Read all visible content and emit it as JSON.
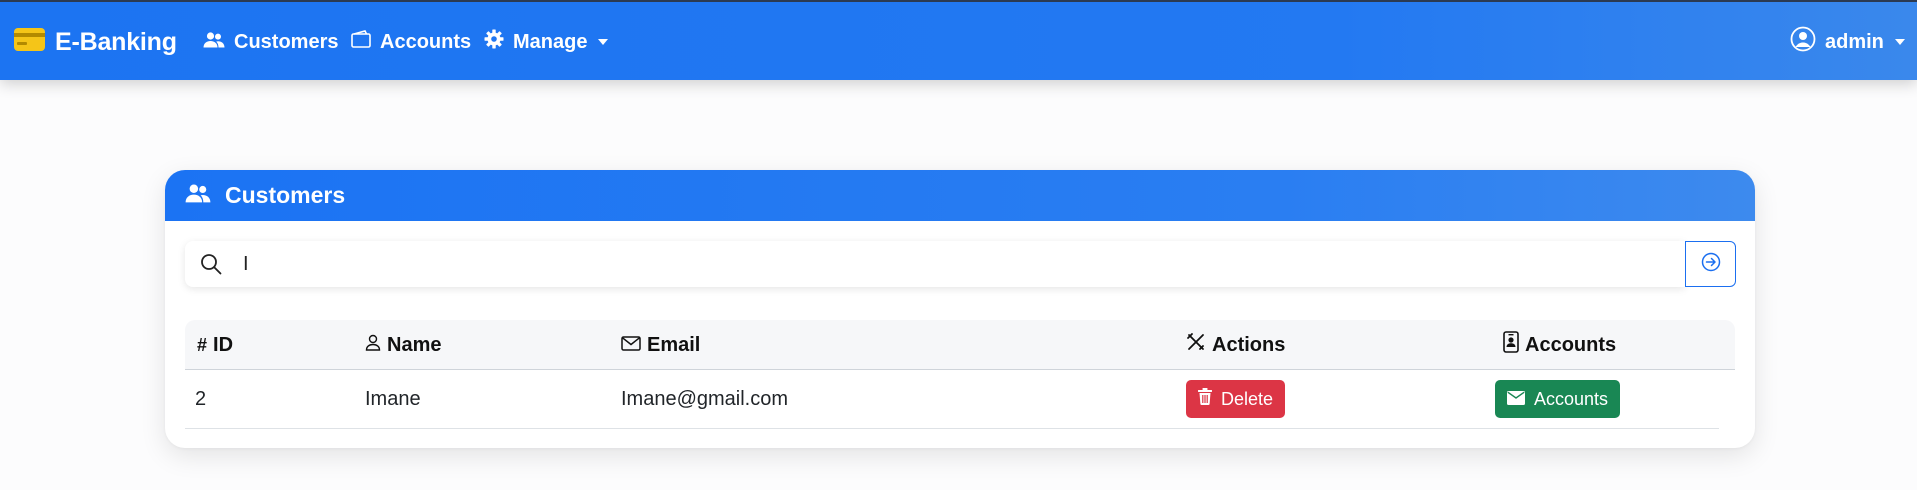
{
  "navbar": {
    "brand": "E-Banking",
    "links": [
      {
        "label": "Customers",
        "icon": "users-icon"
      },
      {
        "label": "Accounts",
        "icon": "wallet-icon"
      },
      {
        "label": "Manage",
        "icon": "gear-icon",
        "dropdown": true
      }
    ],
    "user": {
      "label": "admin",
      "icon": "user-circle-icon",
      "dropdown": true
    }
  },
  "card": {
    "title": "Customers",
    "icon": "users-icon"
  },
  "search": {
    "value": "I",
    "placeholder": "",
    "submit_icon": "arrow-right-circle-icon"
  },
  "table": {
    "columns": [
      {
        "label": "ID",
        "icon": "hash-icon"
      },
      {
        "label": "Name",
        "icon": "person-icon"
      },
      {
        "label": "Email",
        "icon": "envelope-icon"
      },
      {
        "label": "Actions",
        "icon": "tools-icon"
      },
      {
        "label": "Accounts",
        "icon": "badge-icon"
      }
    ],
    "rows": [
      {
        "id": "2",
        "name": "Imane",
        "email": "Imane@gmail.com",
        "delete_label": "Delete",
        "accounts_label": "Accounts"
      }
    ]
  },
  "colors": {
    "primary": "#1c74f2",
    "danger": "#dc3545",
    "success": "#198754",
    "brand_icon": "#f5c518"
  }
}
